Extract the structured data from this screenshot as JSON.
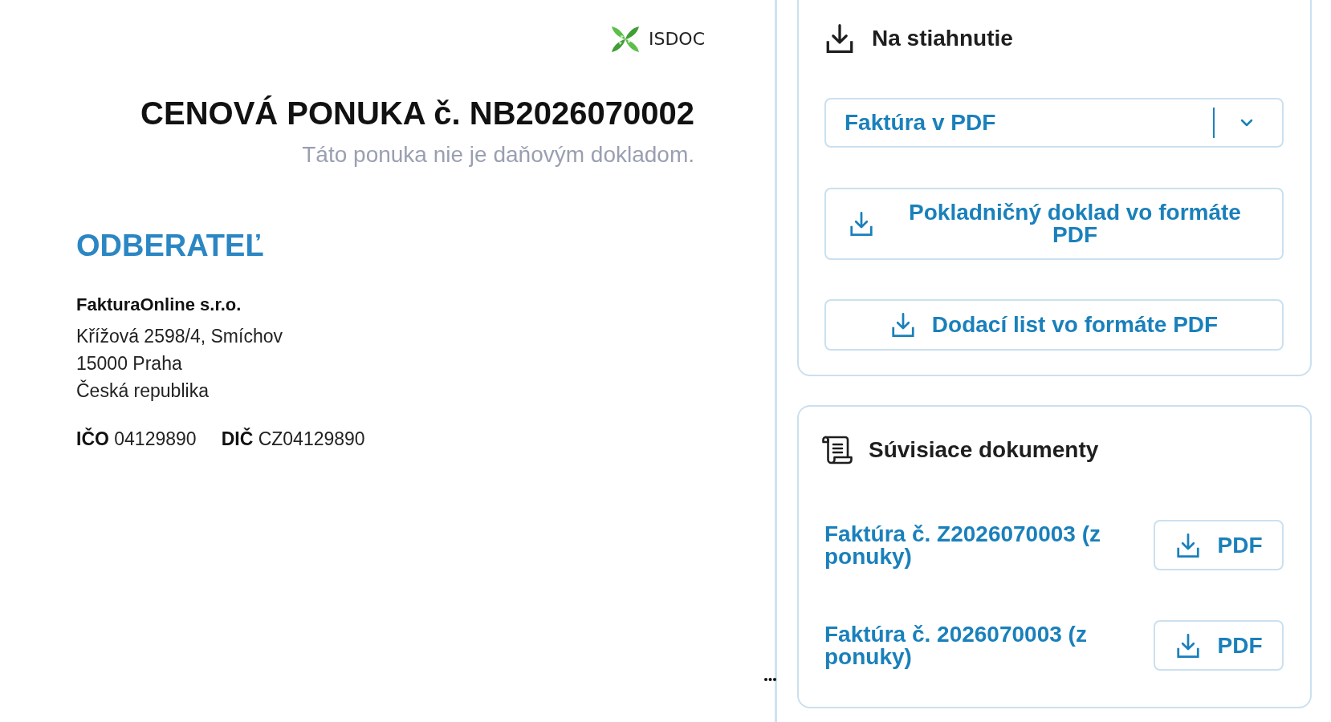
{
  "document": {
    "logo": {
      "text": "ISDOC"
    },
    "title": "CENOVÁ PONUKA č. NB2026070002",
    "subtitle": "Táto ponuka nie je daňovým dokladom.",
    "customer": {
      "heading": "ODBERATEĽ",
      "name": "FakturaOnline s.r.o.",
      "address_lines": [
        "Křížová 2598/4, Smíchov",
        "15000 Praha",
        "Česká republika"
      ],
      "ids": [
        {
          "label": "IČO",
          "value": "04129890"
        },
        {
          "label": "DIČ",
          "value": "CZ04129890"
        }
      ]
    }
  },
  "downloads": {
    "title": "Na stiahnutie",
    "format_select": {
      "value": "Faktúra v PDF"
    },
    "buttons": [
      {
        "label": "Pokladničný doklad vo formáte PDF"
      },
      {
        "label": "Dodací list vo formáte PDF"
      }
    ]
  },
  "related_documents": {
    "title": "Súvisiace dokumenty",
    "items": [
      {
        "label": "Faktúra č. Z2026070003 (z ponuky)",
        "button": "PDF"
      },
      {
        "label": "Faktúra č. 2026070003 (z ponuky)",
        "button": "PDF"
      }
    ]
  }
}
